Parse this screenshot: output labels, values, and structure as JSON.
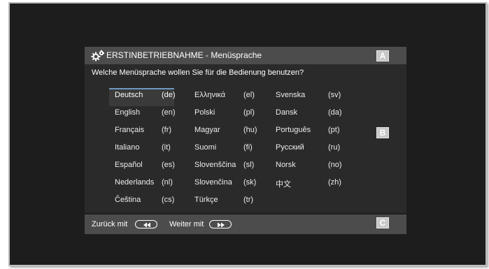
{
  "header": {
    "title": "ERSTINBETRIEBNAHME - Menüsprache",
    "marker_a": "A",
    "marker_b": "B",
    "marker_c": "C"
  },
  "question": "Welche Menüsprache wollen Sie für die Bedienung benutzen?",
  "languages": [
    {
      "name": "Deutsch",
      "code": "(de)",
      "selected": true
    },
    {
      "name": "English",
      "code": "(en)"
    },
    {
      "name": "Français",
      "code": "(fr)"
    },
    {
      "name": "Italiano",
      "code": "(it)"
    },
    {
      "name": "Español",
      "code": "(es)"
    },
    {
      "name": "Nederlands",
      "code": "(nl)"
    },
    {
      "name": "Čeština",
      "code": "(cs)"
    },
    {
      "name": "Ελληνικά",
      "code": "(el)"
    },
    {
      "name": "Polski",
      "code": "(pl)"
    },
    {
      "name": "Magyar",
      "code": "(hu)"
    },
    {
      "name": "Suomi",
      "code": "(fi)"
    },
    {
      "name": "Slovenščina",
      "code": "(sl)"
    },
    {
      "name": "Slovenčina",
      "code": "(sk)"
    },
    {
      "name": "Türkçe",
      "code": "(tr)"
    },
    {
      "name": "Svenska",
      "code": "(sv)"
    },
    {
      "name": "Dansk",
      "code": "(da)"
    },
    {
      "name": "Português",
      "code": "(pt)"
    },
    {
      "name": "Русский",
      "code": "(ru)"
    },
    {
      "name": "Norsk",
      "code": "(no)"
    },
    {
      "name": "中文",
      "code": "(zh)"
    }
  ],
  "footer": {
    "back_label": "Zurück mit",
    "back_icon": "rewind-icon",
    "next_label": "Weiter mit",
    "next_icon": "fast-forward-icon"
  },
  "colors": {
    "panel": "#2a2a2a",
    "bar": "#4c4c4c",
    "highlight": "#6f97c0"
  }
}
